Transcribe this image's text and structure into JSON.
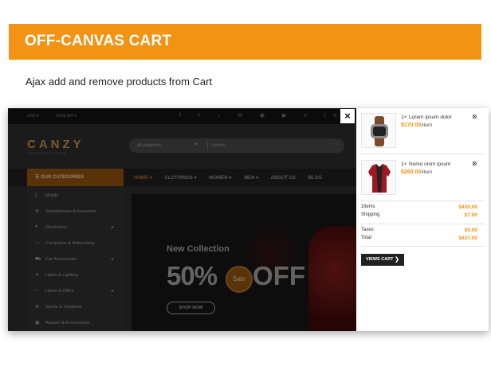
{
  "banner": {
    "title": "OFF-CANVAS CART",
    "color": "#f39313"
  },
  "subtitle": "Ajax add and remove products from Cart",
  "site": {
    "topbar": {
      "currency": "USD ▾",
      "language": "ENGLISH ▾",
      "socials": "f t ♪ ✉ ◉ ▶ v in"
    },
    "logo": "CANZY",
    "logo_sub": "SHOPPING STORE",
    "search": {
      "category": "All categories",
      "placeholder": "Search..."
    },
    "categories_button": "☰  OUR CATEGORIES",
    "nav": [
      "HOME ▾",
      "CLOTHINGS ▾",
      "WOMEN ▾",
      "MEN ▾",
      "ABOUT US",
      "BLOG"
    ],
    "sidebar": [
      {
        "icon": "▯",
        "label": "Mobile",
        "arrow": ""
      },
      {
        "icon": "✣",
        "label": "Smartphones Accessories",
        "arrow": ""
      },
      {
        "icon": "♦",
        "label": "Electronics",
        "arrow": "▸"
      },
      {
        "icon": "▭",
        "label": "Computers & Networking",
        "arrow": ""
      },
      {
        "icon": "⛟",
        "label": "Car Accessories",
        "arrow": "▸"
      },
      {
        "icon": "✦",
        "label": "Lights & Lighting",
        "arrow": ""
      },
      {
        "icon": "⌂",
        "label": "Home & Office",
        "arrow": "▸"
      },
      {
        "icon": "⚙",
        "label": "Sports & Outdoors",
        "arrow": ""
      },
      {
        "icon": "▣",
        "label": "Apparel & Accessories",
        "arrow": ""
      }
    ],
    "hero": {
      "title": "New Collection",
      "percent": "50%",
      "badge": "Sale",
      "off": "OFF",
      "button": "SHOP NOW"
    }
  },
  "close_icon": "×",
  "cart": {
    "items": [
      {
        "qty": "1×",
        "name": "Lorem ipsum dolor",
        "price": "$170.00",
        "unit": "/item",
        "icon": "watch-icon"
      },
      {
        "qty": "1×",
        "name": "Nomo onim ipsum",
        "price": "$260.00",
        "unit": "/item",
        "icon": "jacket-icon"
      }
    ],
    "summary": [
      {
        "label": "2items",
        "value": "$430.00"
      },
      {
        "label": "Shipping",
        "value": "$7.00"
      },
      {
        "label": "Taxes:",
        "value": "$0.00"
      },
      {
        "label": "Total:",
        "value": "$437.00"
      }
    ],
    "view_cart_label": "VIEWS CART",
    "view_cart_chevron": "❯",
    "remove_icon": "⊗"
  }
}
